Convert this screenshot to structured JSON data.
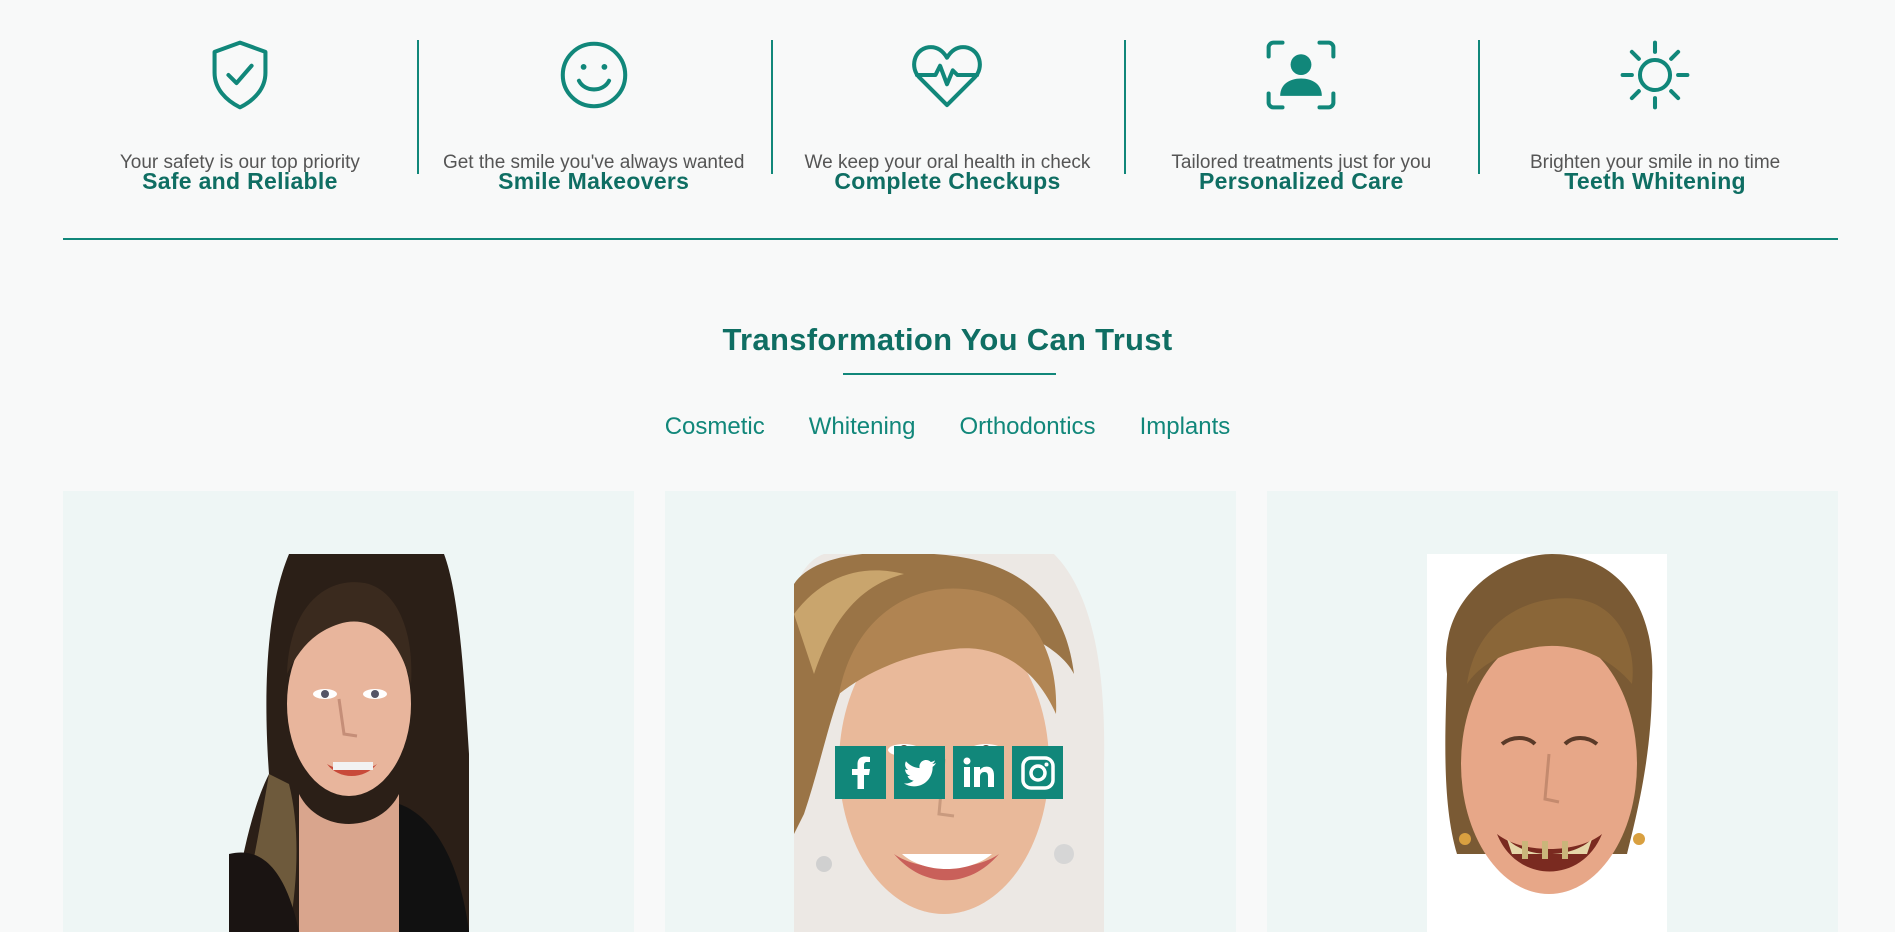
{
  "colors": {
    "accent": "#11877a",
    "heading": "#0f6e63",
    "text_muted": "#555555",
    "card_bg": "#eef6f5"
  },
  "features": [
    {
      "icon": "shield-check-icon",
      "title": "Safe and Reliable",
      "desc": "Your safety is our top priority"
    },
    {
      "icon": "smiley-icon",
      "title": "Smile Makeovers",
      "desc": "Get the smile you've always wanted"
    },
    {
      "icon": "heart-pulse-icon",
      "title": "Complete Checkups",
      "desc": "We keep your oral health in check"
    },
    {
      "icon": "person-scan-icon",
      "title": "Personalized Care",
      "desc": "Tailored treatments just for you"
    },
    {
      "icon": "sun-icon",
      "title": "Teeth Whitening",
      "desc": "Brighten your smile in no time"
    }
  ],
  "section": {
    "title": "Transformation You Can Trust"
  },
  "tabs": [
    "Cosmetic",
    "Whitening",
    "Orthodontics",
    "Implants"
  ],
  "social": [
    "facebook-icon",
    "twitter-icon",
    "linkedin-icon",
    "instagram-icon"
  ]
}
